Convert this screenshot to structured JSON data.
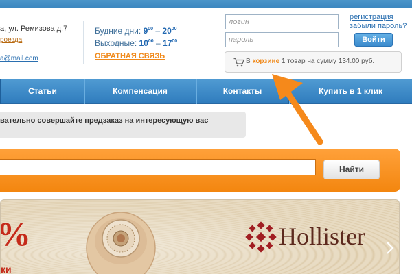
{
  "header": {
    "address": "а, ул. Ремизова д.7",
    "route_link": "роезда",
    "email_link": "a@mail.com",
    "weekdays": {
      "label": "Будние дни:",
      "from": "9",
      "from_sup": "00",
      "dash": " – ",
      "to": "20",
      "to_sup": "00"
    },
    "weekend": {
      "label": "Выходные:",
      "from": "10",
      "from_sup": "00",
      "dash": " – ",
      "to": "17",
      "to_sup": "00"
    },
    "feedback_link": "ОБРАТНАЯ СВЯЗЬ"
  },
  "login": {
    "username_placeholder": "логин",
    "password_placeholder": "пароль",
    "register_link": "регистрация",
    "forgot_link": "забыли пароль?",
    "submit_label": "Войти"
  },
  "cart": {
    "prefix": "В",
    "link": "корзине",
    "summary": "1 товар на сумму 134.00 руб.",
    "icon": "cart-icon"
  },
  "nav": {
    "items": [
      {
        "label": "Статьи"
      },
      {
        "label": "Компенсация"
      },
      {
        "label": "Контакты"
      },
      {
        "label": "Купить в 1 клик"
      }
    ]
  },
  "notice": {
    "text": "вательно совершайте предзаказ на интересующую вас"
  },
  "search": {
    "value": "",
    "button_label": "Найти"
  },
  "banner": {
    "percent": "%",
    "caption": "ки",
    "brand": "Hollister",
    "next_icon": "chevron-right-icon"
  },
  "colors": {
    "nav_blue": "#3b86c6",
    "accent_orange": "#f5891b",
    "link_blue": "#2a6fb0",
    "brand_red": "#c52a1a"
  }
}
